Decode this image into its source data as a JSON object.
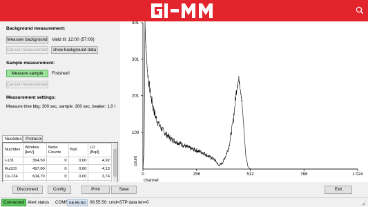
{
  "app": {
    "brand": "GI-MM",
    "help_icon": "search-icon"
  },
  "background": {
    "title": "Background measurement:",
    "measure_button": "Measure background",
    "valid_til": "Valid til: 12:00 (57:09)",
    "cancel_button": "Cancel measurement",
    "show_button": "show background data"
  },
  "sample": {
    "title": "Sample measurement:",
    "measure_button": "Measure sample",
    "status": "Finished!",
    "cancel_button": "Cancel measurement"
  },
  "settings": {
    "title": "Measurement settings:",
    "text": "Measure time bkg: 300 sec, sample: 300 sec, beaker: 1.0 l"
  },
  "tabs": [
    "Nuclides",
    "Protocol"
  ],
  "table": {
    "headers": [
      "Nuclides",
      "Window\n[keV]",
      "Netto\nCounts",
      "Bq/l",
      "LD\n[Bq/l]"
    ],
    "rows": [
      [
        "I-131",
        "364,50",
        "0",
        "0,00",
        "4,92"
      ],
      [
        "Ru103",
        "497,00",
        "0",
        "0,00",
        "4,13"
      ],
      [
        "Cs-134",
        "604,70",
        "0",
        "0,00",
        "3,74"
      ],
      [
        "Cs-137",
        "661,70",
        "0",
        "0,00",
        "3,84"
      ],
      [
        "Cs-134",
        "795,80",
        "33",
        "0,00",
        "4,03"
      ],
      [
        "K-40",
        "1.460,80",
        "7.560",
        "743,40",
        "5,41"
      ]
    ]
  },
  "bottom_buttons": {
    "disconnect": "Disconnect",
    "config": "Config",
    "print": "Print",
    "save": "Save",
    "exit": "Exit"
  },
  "status": {
    "connected": "Connected",
    "alert": "Alert status",
    "port": "COM6",
    "time": "08:55:50",
    "message": "08:55:50: cmd=STP data len=0"
  },
  "colors": {
    "brand_red": "#e2252c",
    "connected_green": "#5fc95f",
    "sample_button_green": "#9de39d"
  },
  "chart_data": {
    "type": "line",
    "title": "",
    "xlabel": "channel",
    "ylabel": "count",
    "xlim": [
      0,
      1024
    ],
    "ylim": [
      0,
      401
    ],
    "xticks": [
      "0",
      "256",
      "512",
      "768",
      "1.024"
    ],
    "yticks": [
      "100",
      "201",
      "301",
      "401"
    ],
    "series": [
      {
        "x": [
          0,
          6,
          10,
          14,
          18,
          22,
          26,
          30,
          36,
          42,
          50,
          60,
          70,
          80,
          90,
          100,
          110,
          120,
          130,
          140,
          150,
          160,
          170,
          180,
          190,
          200,
          210,
          220,
          230,
          240,
          250,
          260,
          270,
          280,
          290,
          300,
          310,
          320,
          330,
          340,
          350,
          360,
          370,
          380,
          390,
          400,
          410,
          420,
          430,
          440,
          450,
          460,
          470,
          480,
          490,
          500,
          505,
          510,
          515,
          520,
          525,
          530,
          540,
          560,
          600,
          700,
          800,
          900,
          1024
        ],
        "y": [
          0,
          60,
          395,
          340,
          300,
          265,
          250,
          230,
          205,
          188,
          165,
          145,
          130,
          118,
          110,
          102,
          96,
          90,
          85,
          80,
          78,
          74,
          72,
          70,
          66,
          64,
          60,
          58,
          56,
          54,
          52,
          50,
          48,
          46,
          44,
          40,
          36,
          32,
          30,
          26,
          20,
          10,
          12,
          18,
          30,
          45,
          60,
          95,
          130,
          185,
          235,
          245,
          200,
          120,
          40,
          8,
          3,
          1,
          0,
          0,
          0,
          0,
          0,
          0,
          0,
          0,
          0,
          0,
          0
        ]
      }
    ]
  }
}
